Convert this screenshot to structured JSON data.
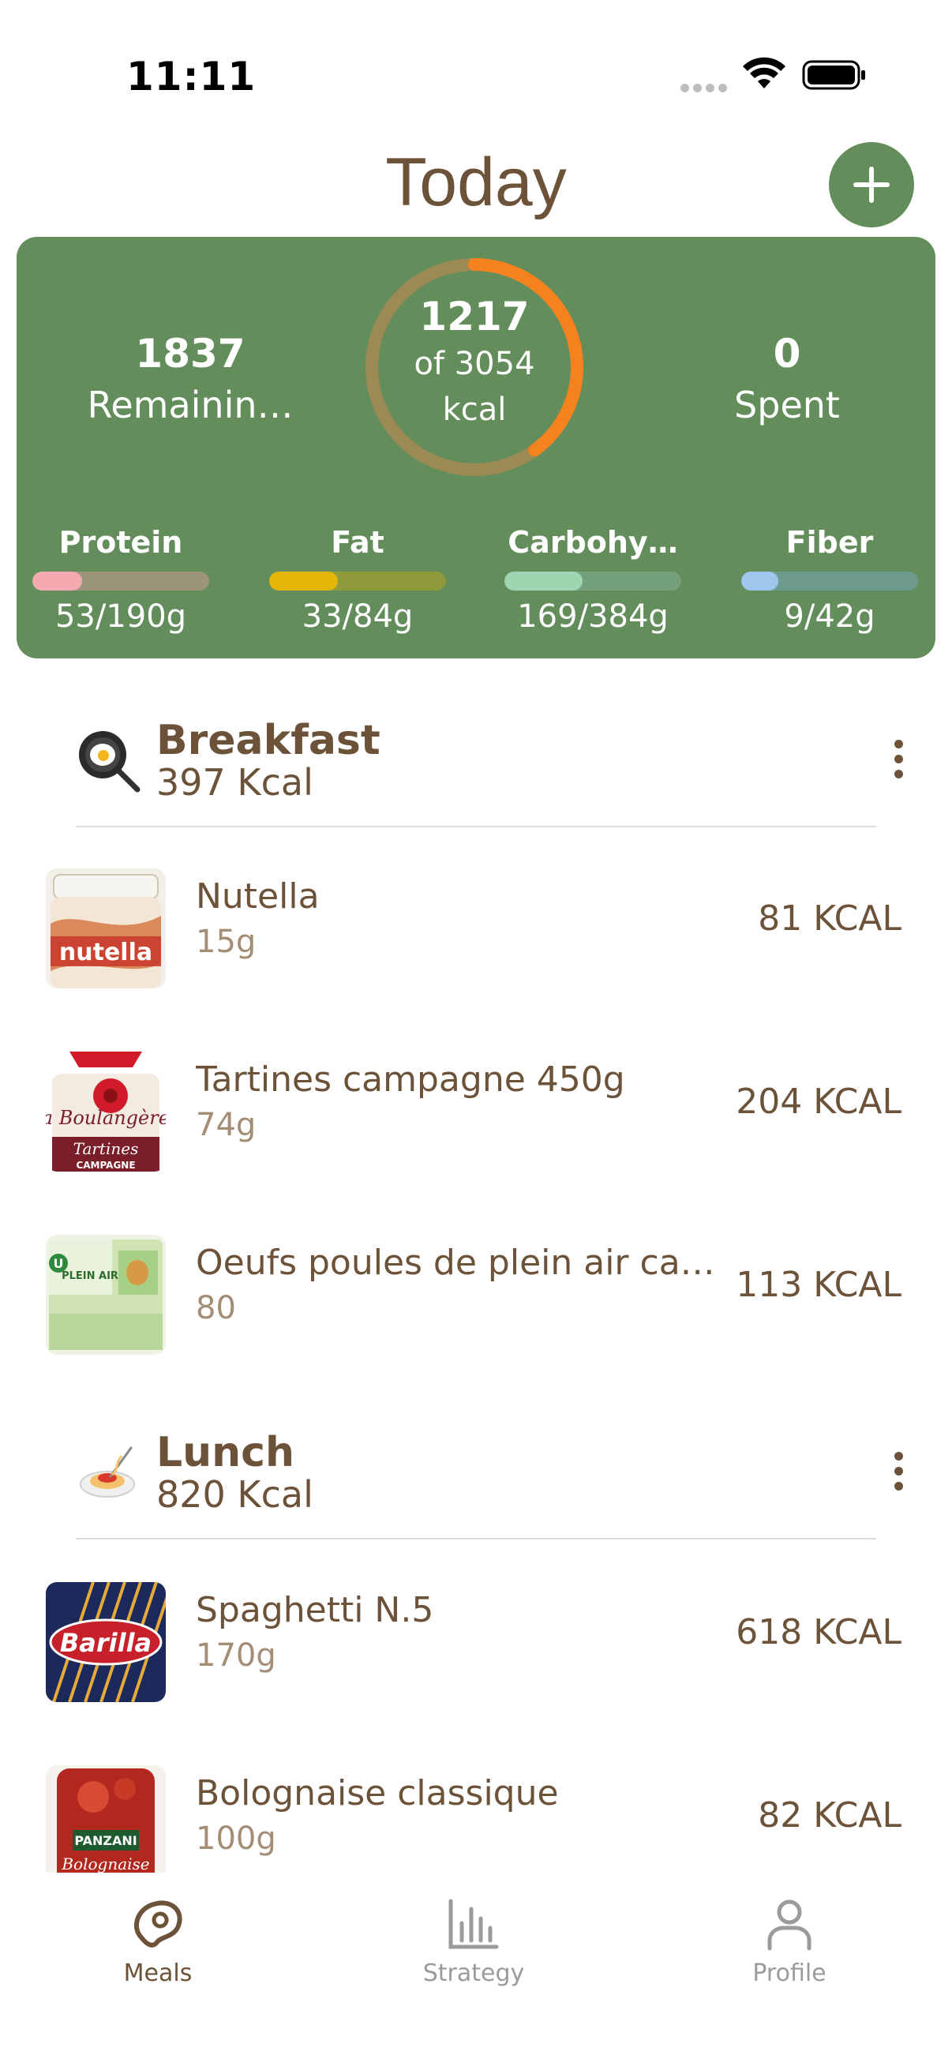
{
  "status_bar": {
    "time": "11:11"
  },
  "header": {
    "title": "Today",
    "add_icon": "plus-icon"
  },
  "summary": {
    "remaining_value": "1837",
    "remaining_label": "Remainin…",
    "ring_value": "1217",
    "ring_of": "of 3054",
    "ring_unit": "kcal",
    "ring_progress": 0.4,
    "spent_value": "0",
    "spent_label": "Spent",
    "colors": {
      "card": "#648d5c",
      "ring_progress": "#f5821f",
      "ring_track": "#9c8a55"
    },
    "macros": [
      {
        "name": "Protein",
        "value": "53/190g",
        "progress": 0.28
      },
      {
        "name": "Fat",
        "value": "33/84g",
        "progress": 0.39
      },
      {
        "name": "Carbohy…",
        "value": "169/384g",
        "progress": 0.44
      },
      {
        "name": "Fiber",
        "value": "9/42g",
        "progress": 0.21
      }
    ]
  },
  "meals": [
    {
      "name": "Breakfast",
      "kcal": "397 Kcal",
      "icon": "frying-pan-egg-icon",
      "items": [
        {
          "name": "Nutella",
          "qty": "15g",
          "kcal": "81 KCAL"
        },
        {
          "name": "Tartines campagne 450g",
          "qty": "74g",
          "kcal": "204 KCAL"
        },
        {
          "name": "Oeufs poules de plein air cal…",
          "qty": "80",
          "kcal": "113 KCAL"
        }
      ]
    },
    {
      "name": "Lunch",
      "kcal": "820 Kcal",
      "icon": "spaghetti-plate-icon",
      "items": [
        {
          "name": "Spaghetti N.5",
          "qty": "170g",
          "kcal": "618 KCAL"
        },
        {
          "name": "Bolognaise classique",
          "qty": "100g",
          "kcal": "82 KCAL"
        }
      ]
    }
  ],
  "thumbnails": {
    "nutella_label": "nutella",
    "tartines_brand": "la Boulangère",
    "tartines_sub": "Tartines",
    "tartines_sub2": "CAMPAGNE",
    "oeufs_label": "PLEIN AIR",
    "barilla_label": "Barilla",
    "panzani_label": "PANZANI",
    "bolognaise_label": "Bolognaise"
  },
  "nav": [
    {
      "label": "Meals",
      "icon": "steak-icon",
      "active": true
    },
    {
      "label": "Strategy",
      "icon": "bar-chart-icon",
      "active": false
    },
    {
      "label": "Profile",
      "icon": "person-icon",
      "active": false
    }
  ]
}
